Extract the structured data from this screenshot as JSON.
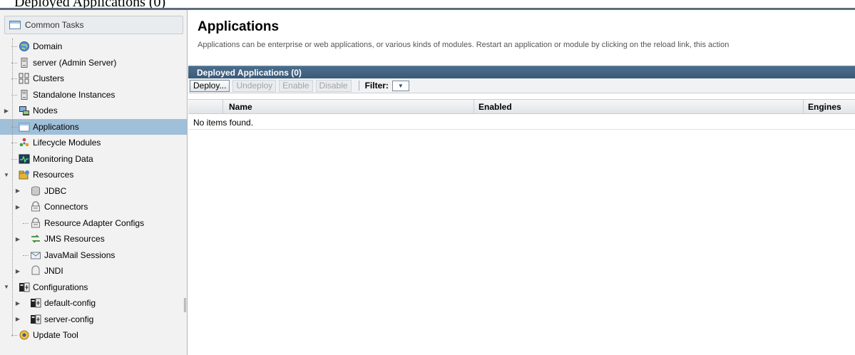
{
  "window_caption": "Deployed Applications (0)",
  "sidebar": {
    "header": {
      "label": "Common Tasks",
      "icon": "table-icon"
    },
    "items": [
      {
        "label": "Domain",
        "icon": "globe-icon",
        "level": 0,
        "expandable": false
      },
      {
        "label": "server (Admin Server)",
        "icon": "server-icon",
        "level": 0,
        "expandable": false
      },
      {
        "label": "Clusters",
        "icon": "cluster-icon",
        "level": 0,
        "expandable": false
      },
      {
        "label": "Standalone Instances",
        "icon": "server-icon",
        "level": 0,
        "expandable": false
      },
      {
        "label": "Nodes",
        "icon": "nodes-icon",
        "level": 0,
        "expandable": true,
        "expanded": false
      },
      {
        "label": "Applications",
        "icon": "applications-icon",
        "level": 0,
        "expandable": false,
        "selected": true
      },
      {
        "label": "Lifecycle Modules",
        "icon": "lifecycle-icon",
        "level": 0,
        "expandable": false
      },
      {
        "label": "Monitoring Data",
        "icon": "monitor-icon",
        "level": 0,
        "expandable": false
      },
      {
        "label": "Resources",
        "icon": "resources-icon",
        "level": 0,
        "expandable": true,
        "expanded": true
      },
      {
        "label": "JDBC",
        "icon": "database-icon",
        "level": 1,
        "expandable": true,
        "expanded": false
      },
      {
        "label": "Connectors",
        "icon": "connector-icon",
        "level": 1,
        "expandable": true,
        "expanded": false
      },
      {
        "label": "Resource Adapter Configs",
        "icon": "connector-icon",
        "level": 1,
        "expandable": false
      },
      {
        "label": "JMS Resources",
        "icon": "jms-icon",
        "level": 1,
        "expandable": true,
        "expanded": false
      },
      {
        "label": "JavaMail Sessions",
        "icon": "mail-icon",
        "level": 1,
        "expandable": false
      },
      {
        "label": "JNDI",
        "icon": "jndi-icon",
        "level": 1,
        "expandable": true,
        "expanded": false
      },
      {
        "label": "Configurations",
        "icon": "config-icon",
        "level": 0,
        "expandable": true,
        "expanded": true
      },
      {
        "label": "default-config",
        "icon": "config-icon",
        "level": 1,
        "expandable": true,
        "expanded": false
      },
      {
        "label": "server-config",
        "icon": "config-icon",
        "level": 1,
        "expandable": true,
        "expanded": false
      },
      {
        "label": "Update Tool",
        "icon": "update-tool-icon",
        "level": 0,
        "expandable": false
      }
    ]
  },
  "main": {
    "title": "Applications",
    "description": "Applications can be enterprise or web applications, or various kinds of modules. Restart an application or module by clicking on the reload link, this action",
    "table": {
      "title": "Deployed Applications (0)",
      "buttons": [
        {
          "label": "Deploy...",
          "enabled": true
        },
        {
          "label": "Undeploy",
          "enabled": false
        },
        {
          "label": "Enable",
          "enabled": false
        },
        {
          "label": "Disable",
          "enabled": false
        }
      ],
      "filter_label": "Filter:",
      "columns": [
        "Name",
        "Enabled",
        "Engines"
      ],
      "empty_message": "No items found."
    }
  },
  "colors": {
    "selected_row": "#a0bfd8",
    "table_title_bg": "#3f5f7d",
    "disabled_text": "#a3a3a3"
  }
}
